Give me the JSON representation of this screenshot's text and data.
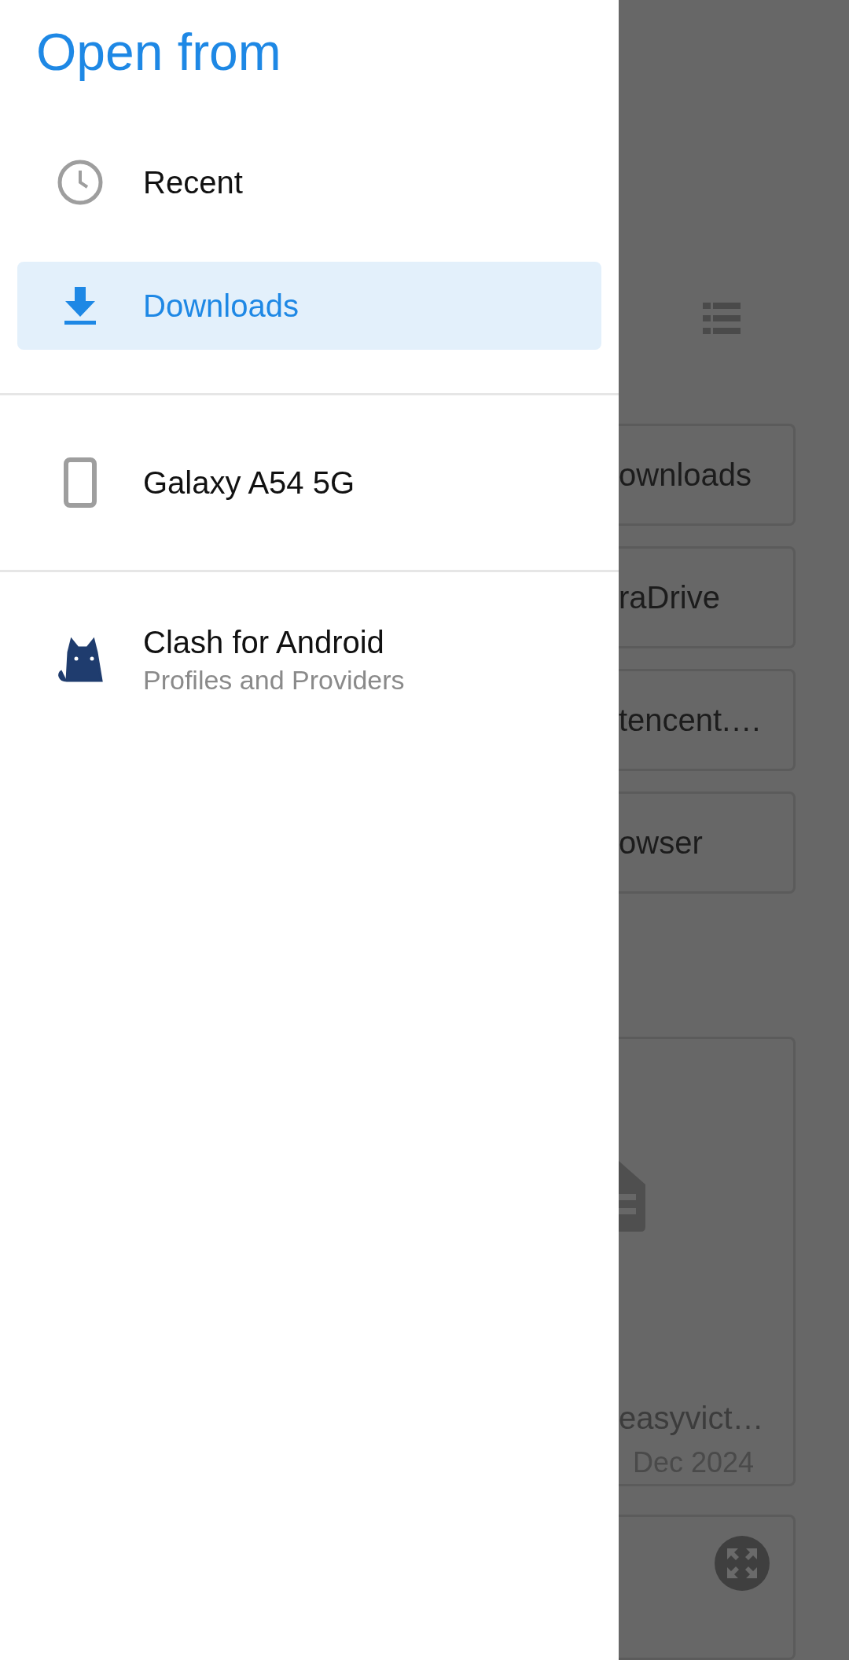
{
  "drawer": {
    "title": "Open from",
    "sections": [
      [
        {
          "kind": "recent",
          "label": "Recent",
          "selected": false
        },
        {
          "kind": "downloads",
          "label": "Downloads",
          "selected": true
        }
      ],
      [
        {
          "kind": "device",
          "label": "Galaxy A54 5G",
          "selected": false
        }
      ],
      [
        {
          "kind": "app",
          "label": "Clash for Android",
          "subtitle": "Profiles and Providers",
          "selected": false
        }
      ]
    ]
  },
  "background": {
    "folders": [
      "ownloads",
      "raDrive",
      "tencent.…",
      "owser"
    ],
    "file": {
      "name": "easyvict…",
      "date": "Dec 2024"
    }
  }
}
